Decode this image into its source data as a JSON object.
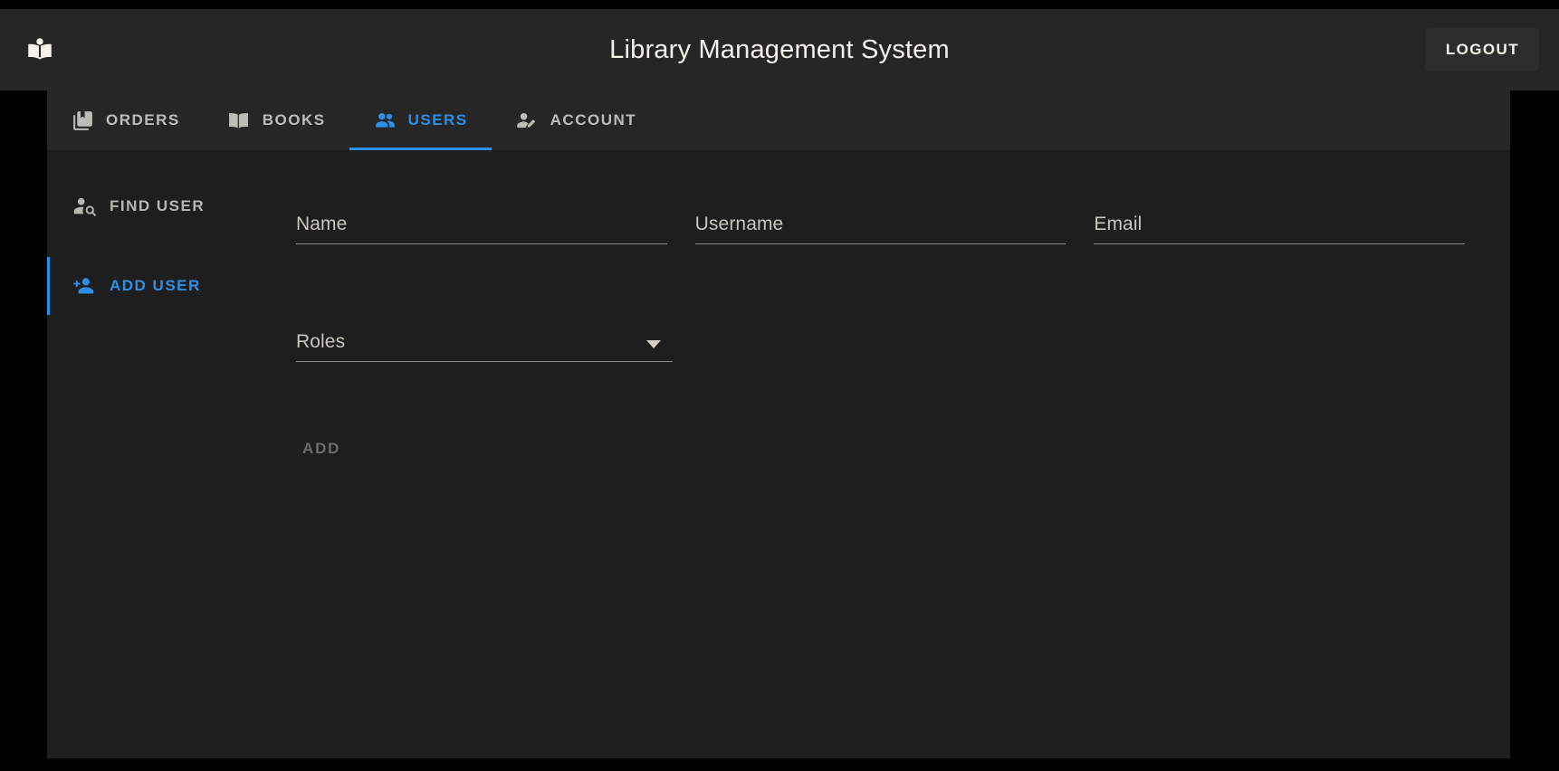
{
  "header": {
    "title": "Library Management System",
    "logo_icon": "local-library-icon",
    "logout_label": "LOGOUT"
  },
  "tabs": [
    {
      "label": "ORDERS",
      "icon": "library-books-icon",
      "active": false
    },
    {
      "label": "BOOKS",
      "icon": "menu-book-icon",
      "active": false
    },
    {
      "label": "USERS",
      "icon": "people-icon",
      "active": true
    },
    {
      "label": "ACCOUNT",
      "icon": "manage-accounts-icon",
      "active": false
    }
  ],
  "sidebar": {
    "items": [
      {
        "label": "FIND USER",
        "icon": "person-search-icon",
        "active": false
      },
      {
        "label": "ADD USER",
        "icon": "person-add-icon",
        "active": true
      }
    ]
  },
  "form": {
    "fields": [
      {
        "name": "name",
        "label": "Name",
        "value": "",
        "placeholder": "Name"
      },
      {
        "name": "username",
        "label": "Username",
        "value": "",
        "placeholder": "Username"
      },
      {
        "name": "email",
        "label": "Email",
        "value": "",
        "placeholder": "Email"
      }
    ],
    "roles": {
      "label": "Roles",
      "value": "",
      "placeholder": "Roles"
    },
    "submit_label": "ADD"
  },
  "colors": {
    "accent": "#2b90e8",
    "page_background": "#000000",
    "header_background": "#262626",
    "panel_background": "#1e1e1e",
    "text_primary": "#f3f1ea",
    "text_muted": "#b8b6b0",
    "text_disabled": "#6e6c68"
  }
}
